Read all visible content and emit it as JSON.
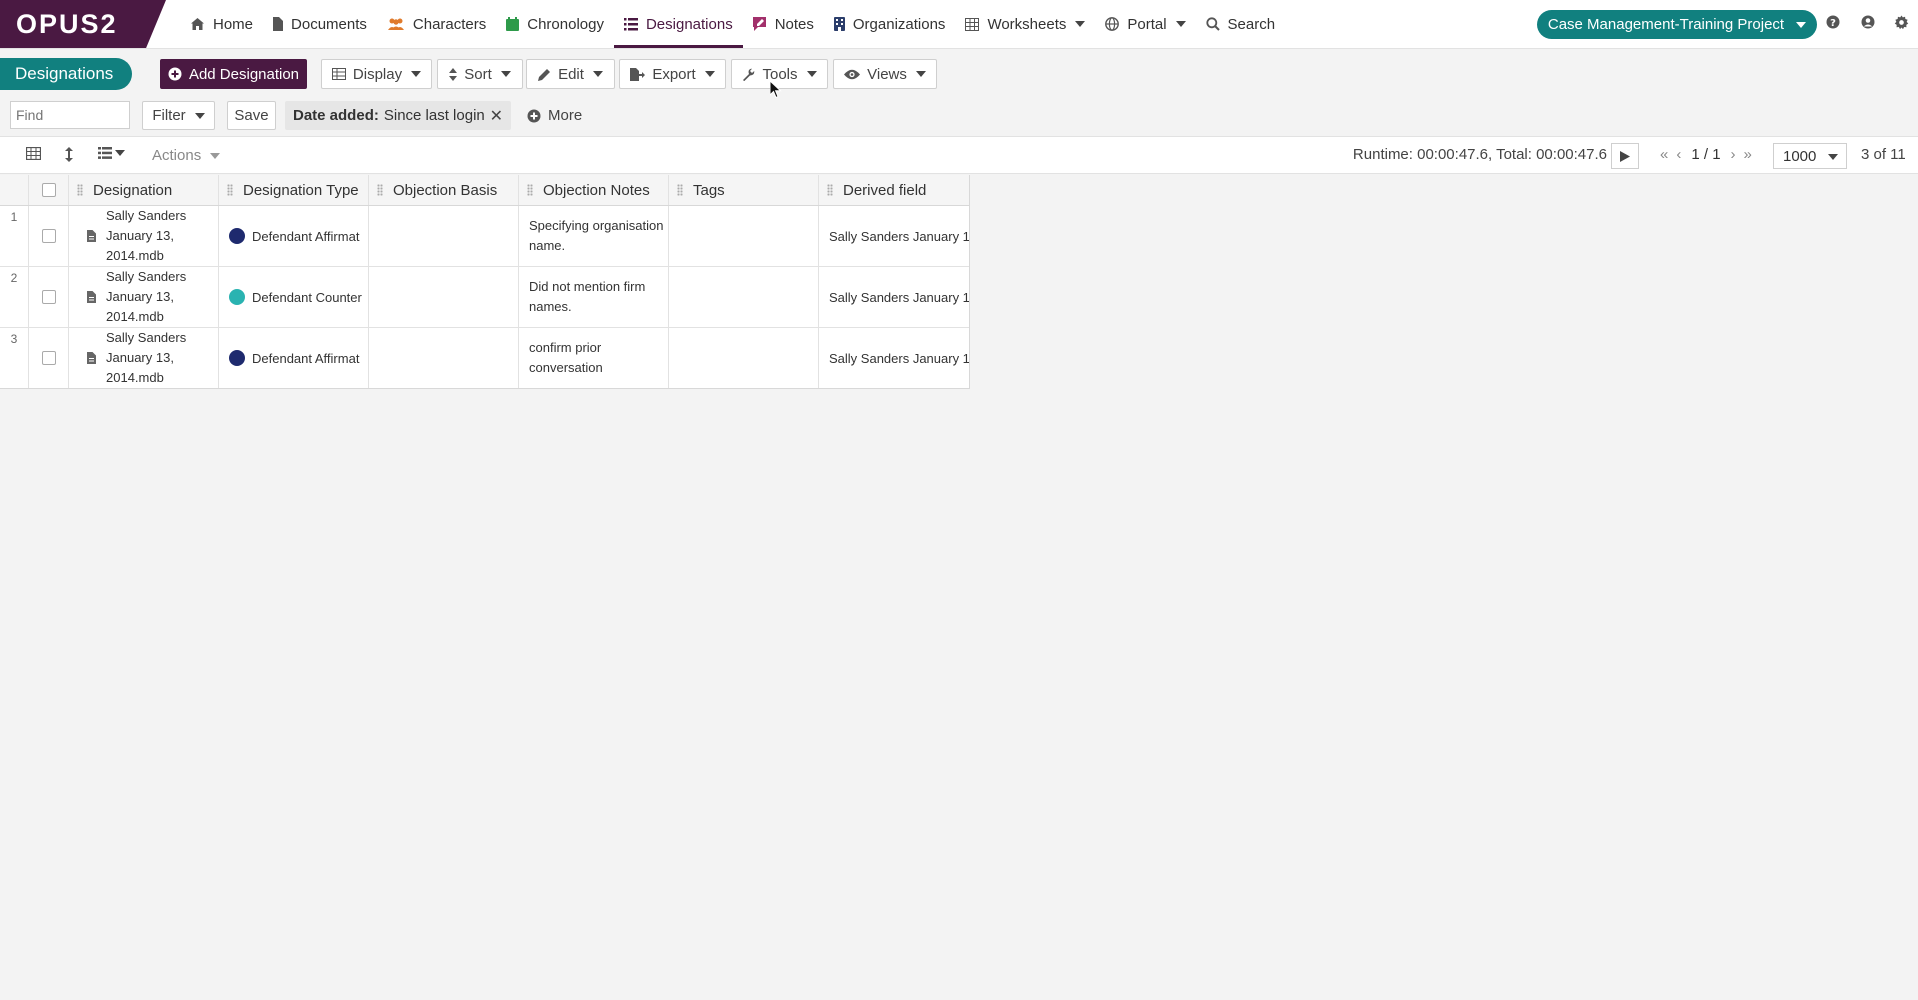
{
  "app": {
    "logo": "OPUS2",
    "project": "Case Management-Training Project"
  },
  "nav": [
    {
      "label": "Home",
      "icon": "home-icon"
    },
    {
      "label": "Documents",
      "icon": "document-icon"
    },
    {
      "label": "Characters",
      "icon": "people-icon"
    },
    {
      "label": "Chronology",
      "icon": "calendar-icon"
    },
    {
      "label": "Designations",
      "icon": "list-icon"
    },
    {
      "label": "Notes",
      "icon": "note-icon"
    },
    {
      "label": "Organizations",
      "icon": "building-icon"
    },
    {
      "label": "Worksheets",
      "icon": "table-icon"
    },
    {
      "label": "Portal",
      "icon": "globe-icon"
    },
    {
      "label": "Search",
      "icon": "search-icon"
    }
  ],
  "page": {
    "tab_label": "Designations"
  },
  "toolbar": {
    "add_label": "Add Designation",
    "display_label": "Display",
    "sort_label": "Sort",
    "edit_label": "Edit",
    "export_label": "Export",
    "tools_label": "Tools",
    "views_label": "Views"
  },
  "filters": {
    "find_placeholder": "Find",
    "filter_label": "Filter",
    "save_label": "Save",
    "chip_key": "Date added:",
    "chip_value": "Since last login",
    "more_label": "More"
  },
  "grid_toolbar": {
    "actions_label": "Actions",
    "runtime": "Runtime: 00:00:47.6, Total: 00:00:47.6",
    "page": "1 / 1",
    "per_page": "1000",
    "count": "3 of 11"
  },
  "table": {
    "columns": [
      "Designation",
      "Designation Type",
      "Objection Basis",
      "Objection Notes",
      "Tags",
      "Derived field"
    ],
    "rows": [
      {
        "num": "1",
        "designation": "Sally Sanders January 13, 2014.mdb",
        "type": "Defendant Affirmat",
        "type_color": "#1e2a6e",
        "basis": "",
        "notes": "Specifying organisation name.",
        "tags": "",
        "derived": "Sally Sanders January 1"
      },
      {
        "num": "2",
        "designation": "Sally Sanders January 13, 2014.mdb",
        "type": "Defendant Counter",
        "type_color": "#2ab3b1",
        "basis": "",
        "notes": "Did not mention firm names.",
        "tags": "",
        "derived": "Sally Sanders January 1"
      },
      {
        "num": "3",
        "designation": "Sally Sanders January 13, 2014.mdb",
        "type": "Defendant Affirmat",
        "type_color": "#1e2a6e",
        "basis": "",
        "notes": "confirm prior conversation",
        "tags": "",
        "derived": "Sally Sanders January 1"
      }
    ]
  },
  "colors": {
    "brand": "#4a1942",
    "accent": "#11807f"
  }
}
